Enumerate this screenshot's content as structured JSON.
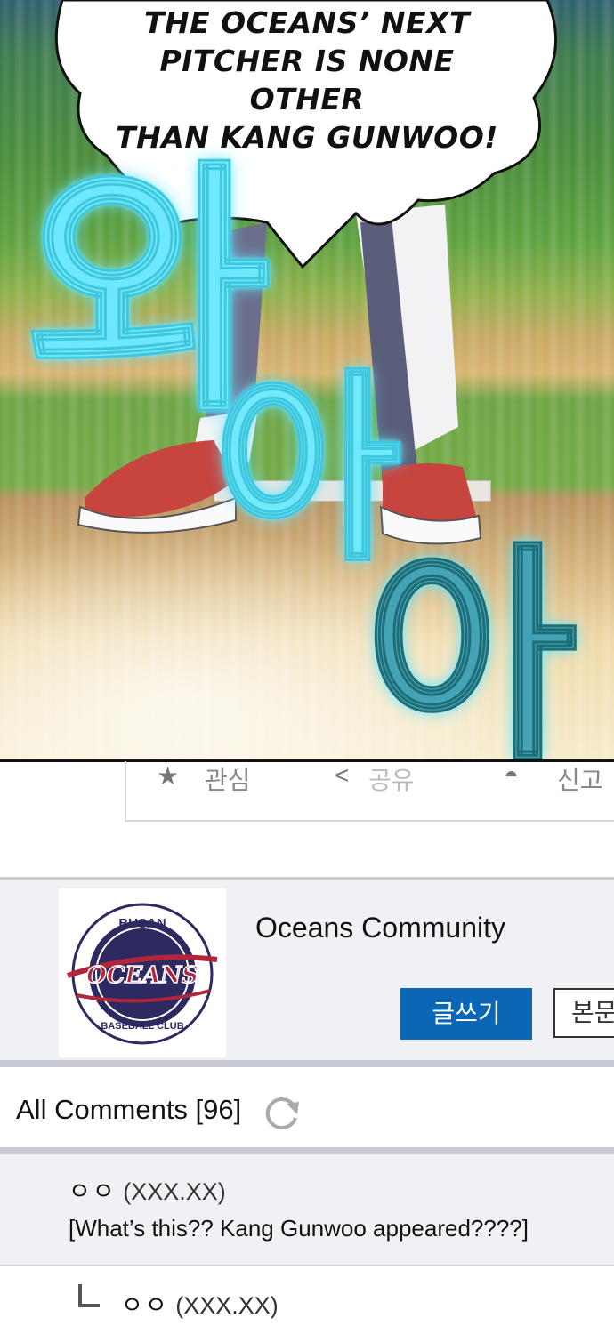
{
  "panel": {
    "caption": "THE OCEANS' NEXT PITCHER IS NONE OTHER THAN KANG GUNWOO!",
    "caption_lines": [
      "THE OCEANS’ NEXT",
      "PITCHER IS NONE OTHER",
      "THAN KANG GUNWOO!"
    ],
    "sfx": [
      "와",
      "아",
      "아"
    ]
  },
  "below_panel": {
    "favorite_label": "관심",
    "share_label": "공유",
    "report_label": "신고"
  },
  "community": {
    "logo_text_top": "BUSAN",
    "logo_text_main": "OCEANS",
    "logo_text_bottom": "BASEBALL CLUB",
    "title": "Oceans Community",
    "write_button": "글쓰기",
    "body_button": "본문"
  },
  "comments": {
    "header": "All Comments [96]",
    "items": [
      {
        "author_icon": "ㅇㅇ",
        "author": "(XXX.XX)",
        "text": "[What’s this?? Kang Gunwoo appeared????]"
      },
      {
        "author_icon": "ㅇㅇ",
        "author": "(XXX.XX)",
        "text": ""
      }
    ]
  },
  "colors": {
    "accent_blue": "#0b67b5",
    "sfx_cyan": "#3fc7e0",
    "logo_navy": "#2d2a62",
    "logo_red": "#b3263a"
  }
}
